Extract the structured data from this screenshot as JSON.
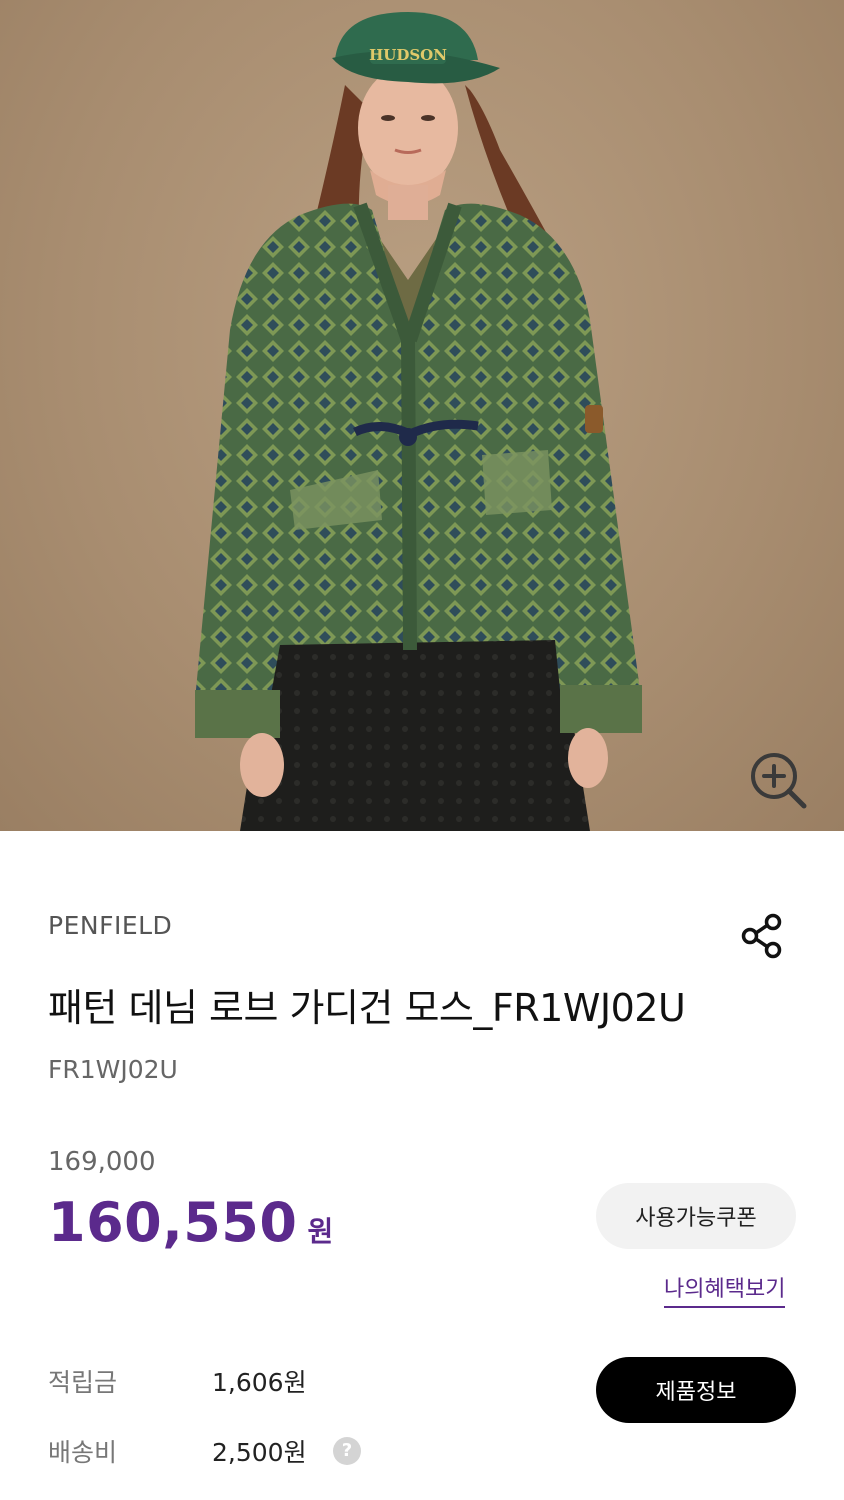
{
  "product": {
    "brand": "PENFIELD",
    "title": "패턴 데님 로브 가디건 모스_FR1WJ02U",
    "code": "FR1WJ02U",
    "original_price": "169,000",
    "sale_price": "160,550",
    "sale_unit": "원",
    "image_alt": "model wearing green patterned denim robe cardigan",
    "cap_text": "HUDSON"
  },
  "actions": {
    "coupon_label": "사용가능쿠폰",
    "benefit_link": "나의혜택보기",
    "product_info_label": "제품정보"
  },
  "details": {
    "points_label": "적립금",
    "points_value": "1,606원",
    "shipping_label": "배송비",
    "shipping_value": "2,500원",
    "help_icon_glyph": "?"
  },
  "icons": {
    "zoom": "zoom-in-icon",
    "share": "share-icon",
    "help": "question-icon"
  },
  "colors": {
    "accent": "#5b2a8c",
    "background_image": "#a88d70",
    "jacket": "#4b6244",
    "button_dark": "#000000",
    "button_light": "#f2f2f2"
  }
}
